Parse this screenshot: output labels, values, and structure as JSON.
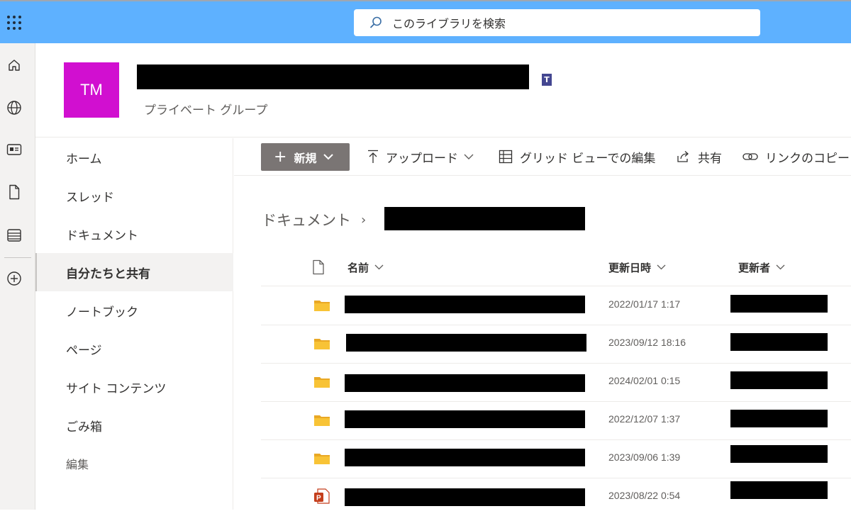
{
  "search": {
    "placeholder": "このライブラリを検索"
  },
  "site": {
    "logo_initials": "TM",
    "subtitle": "プライベート グループ"
  },
  "nav": {
    "items": [
      {
        "label": "ホーム"
      },
      {
        "label": "スレッド"
      },
      {
        "label": "ドキュメント"
      },
      {
        "label": "自分たちと共有"
      },
      {
        "label": "ノートブック"
      },
      {
        "label": "ページ"
      },
      {
        "label": "サイト コンテンツ"
      },
      {
        "label": "ごみ箱"
      },
      {
        "label": "編集"
      }
    ],
    "active_index": 3
  },
  "rail_icons": [
    "home-icon",
    "globe-icon",
    "news-icon",
    "document-icon",
    "list-icon",
    "add-circle-icon"
  ],
  "commands": {
    "new": "新規",
    "upload": "アップロード",
    "grid_edit": "グリッド ビューでの編集",
    "share": "共有",
    "copy_link": "リンクのコピー"
  },
  "breadcrumb": {
    "root": "ドキュメント"
  },
  "columns": {
    "name": "名前",
    "modified": "更新日時",
    "modified_by": "更新者"
  },
  "rows": [
    {
      "type": "folder",
      "modified": "2022/01/17 1:17"
    },
    {
      "type": "folder",
      "modified": "2023/09/12 18:16"
    },
    {
      "type": "folder",
      "modified": "2024/02/01 0:15"
    },
    {
      "type": "folder",
      "modified": "2022/12/07 1:37"
    },
    {
      "type": "folder",
      "modified": "2023/09/06 1:39"
    },
    {
      "type": "pptx",
      "modified": "2023/08/22 0:54"
    }
  ],
  "colors": {
    "topbar": "#5eb1ff",
    "logo": "#d10fd0",
    "new_button": "#7a7574",
    "folder": "#f8c336",
    "pptx": "#c43e1c"
  }
}
